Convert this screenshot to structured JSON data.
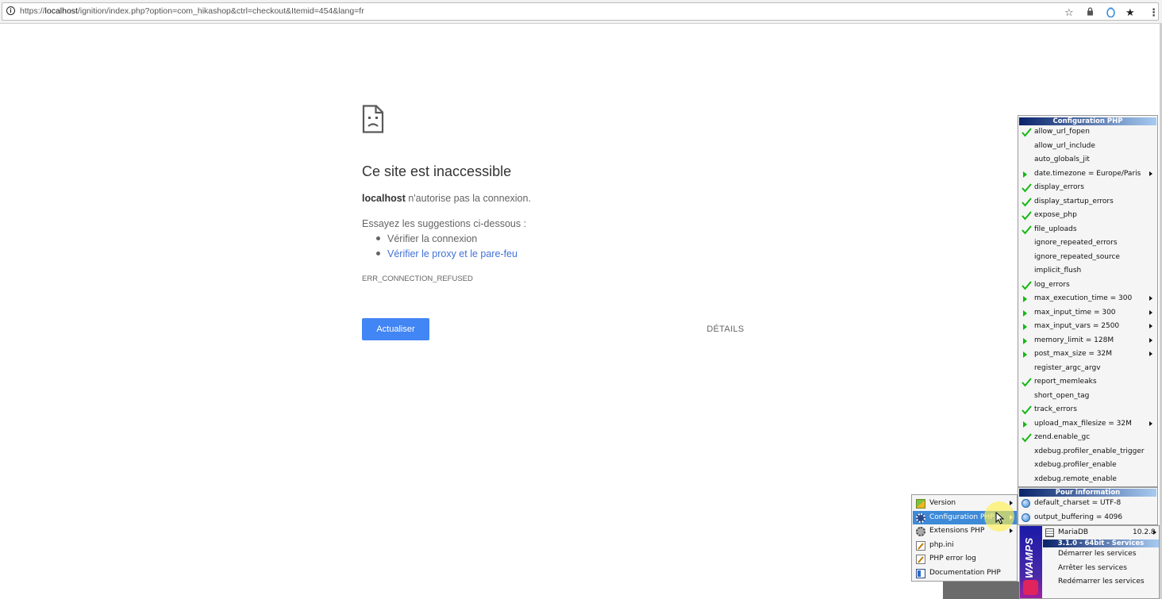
{
  "browser": {
    "url_scheme": "https://",
    "url_host": "localhost",
    "url_path": "/ignition/index.php?option=com_hikashop&ctrl=checkout&Itemid=454&lang=fr",
    "info_glyph": "i",
    "icons": [
      "star-icon",
      "lock-icon",
      "extension-icon",
      "bookmark-star-icon",
      "menu-kebab-icon"
    ]
  },
  "error_page": {
    "title": "Ce site est inaccessible",
    "host": "localhost",
    "desc": " n'autorise pas la connexion.",
    "suggest_intro": "Essayez les suggestions ci-dessous :",
    "suggestions": [
      "Vérifier la connexion",
      "Vérifier le proxy et le pare-feu"
    ],
    "code": "ERR_CONNECTION_REFUSED",
    "reload_label": "Actualiser",
    "details_label": "DÉTAILS",
    "link_color": "#4272d7",
    "button_color": "#4285f4"
  },
  "php_config_menu": {
    "header": "Configuration PHP",
    "items": [
      {
        "label": "allow_url_fopen",
        "mark": "check"
      },
      {
        "label": "allow_url_include",
        "mark": "none"
      },
      {
        "label": "auto_globals_jit",
        "mark": "none"
      },
      {
        "label": "date.timezone = Europe/Paris",
        "mark": "arrow",
        "submenu": true
      },
      {
        "label": "display_errors",
        "mark": "check"
      },
      {
        "label": "display_startup_errors",
        "mark": "check"
      },
      {
        "label": "expose_php",
        "mark": "check"
      },
      {
        "label": "file_uploads",
        "mark": "check"
      },
      {
        "label": "ignore_repeated_errors",
        "mark": "none"
      },
      {
        "label": "ignore_repeated_source",
        "mark": "none"
      },
      {
        "label": "implicit_flush",
        "mark": "none"
      },
      {
        "label": "log_errors",
        "mark": "check"
      },
      {
        "label": "max_execution_time = 300",
        "mark": "arrow",
        "submenu": true
      },
      {
        "label": "max_input_time = 300",
        "mark": "arrow",
        "submenu": true
      },
      {
        "label": "max_input_vars = 2500",
        "mark": "arrow",
        "submenu": true
      },
      {
        "label": "memory_limit = 128M",
        "mark": "arrow",
        "submenu": true
      },
      {
        "label": "post_max_size = 32M",
        "mark": "arrow",
        "submenu": true
      },
      {
        "label": "register_argc_argv",
        "mark": "none"
      },
      {
        "label": "report_memleaks",
        "mark": "check"
      },
      {
        "label": "short_open_tag",
        "mark": "none"
      },
      {
        "label": "track_errors",
        "mark": "check"
      },
      {
        "label": "upload_max_filesize = 32M",
        "mark": "arrow",
        "submenu": true
      },
      {
        "label": "zend.enable_gc",
        "mark": "check"
      },
      {
        "label": "xdebug.profiler_enable_trigger",
        "mark": "none"
      },
      {
        "label": "xdebug.profiler_enable",
        "mark": "none"
      },
      {
        "label": "xdebug.remote_enable",
        "mark": "none"
      }
    ]
  },
  "info_menu": {
    "header": "Pour information",
    "items": [
      "default_charset = UTF-8",
      "output_buffering = 4096"
    ]
  },
  "main_menu": {
    "items": [
      {
        "label": "Version",
        "icon": "version-icon",
        "submenu": true,
        "selected": false
      },
      {
        "label": "Configuration PHP",
        "icon": "gear-icon",
        "submenu": true,
        "selected": true
      },
      {
        "label": "Extensions PHP",
        "icon": "extensions-gear-icon",
        "submenu": true,
        "selected": false
      },
      {
        "label": "php.ini",
        "icon": "edit-file-icon",
        "submenu": false,
        "selected": false
      },
      {
        "label": "PHP error log",
        "icon": "edit-file-icon",
        "submenu": false,
        "selected": false
      },
      {
        "label": "Documentation PHP",
        "icon": "documentation-icon",
        "submenu": false,
        "selected": false
      }
    ]
  },
  "wamp_menu": {
    "brand": "WAMPS",
    "mariadb_label": "MariaDB",
    "mariadb_version": "10.2.8",
    "header": "3.1.0 - 64bit - Services",
    "items": [
      "Démarrer les services",
      "Arrêter les services",
      "Redémarrer les services"
    ]
  },
  "colors": {
    "check": "#11b811",
    "menu_header_start": "#0a246a",
    "menu_header_end": "#a6caf0",
    "selected_item": "#3d8ad8"
  }
}
